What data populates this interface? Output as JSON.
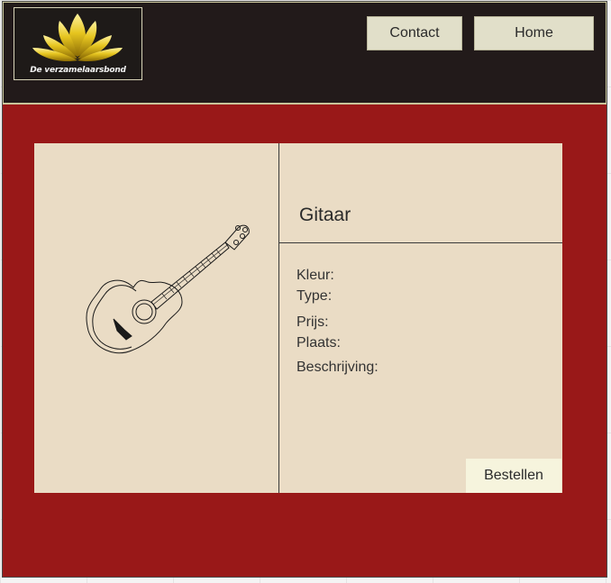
{
  "header": {
    "logo_text": "De verzamelaarsbond",
    "nav": {
      "contact_label": "Contact",
      "home_label": "Home"
    }
  },
  "product": {
    "title": "Gitaar",
    "image_icon": "guitar-icon",
    "fields": {
      "color_label": "Kleur:",
      "type_label": "Type:",
      "price_label": "Prijs:",
      "location_label": "Plaats:",
      "description_label": "Beschrijving:"
    },
    "order_label": "Bestellen"
  },
  "colors": {
    "header_bg": "#221a1a",
    "page_bg": "#991818",
    "card_bg": "#eadcc5",
    "nav_button_bg": "#e1dfc9",
    "order_button_bg": "#f6f4dd",
    "logo_gold": "#e0c220"
  }
}
